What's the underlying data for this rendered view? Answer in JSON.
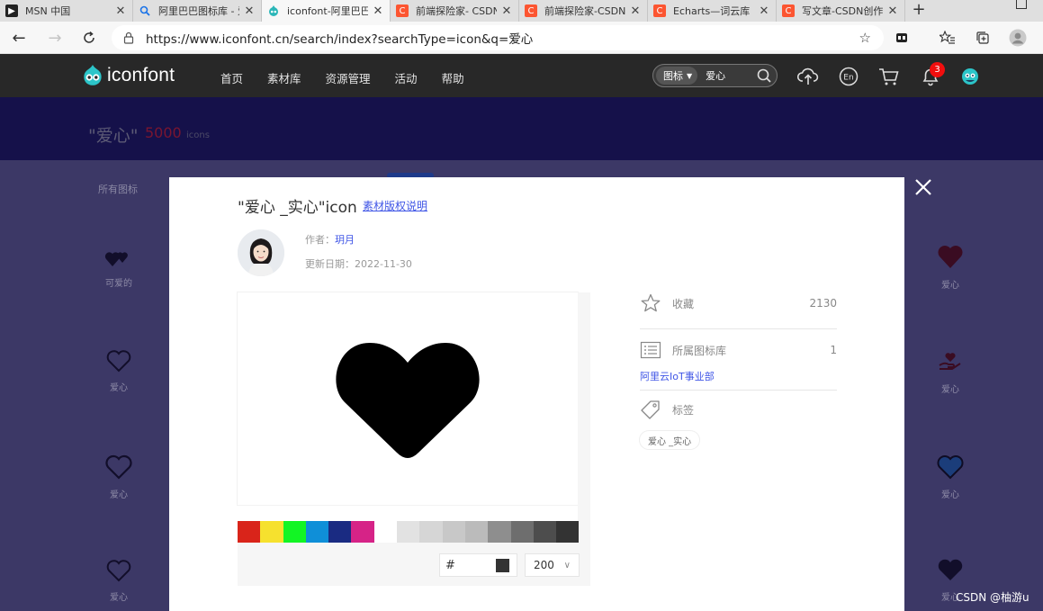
{
  "browser": {
    "tabs": [
      {
        "title": "MSN 中国",
        "icon": "msn-icon",
        "icon_color": "#222222"
      },
      {
        "title": "阿里巴巴图标库 - 爱心",
        "icon": "search-icon",
        "icon_color": "#1a73e8"
      },
      {
        "title": "iconfont-阿里巴巴矢量图标库",
        "icon": "iconfont-icon",
        "icon_color": "#2bb6b8"
      },
      {
        "title": "前端探险家- CSDN博客",
        "icon": "csdn-icon",
        "icon_color": "#fc5531"
      },
      {
        "title": "前端探险家-CSDN博客",
        "icon": "csdn-icon",
        "icon_color": "#fc5531"
      },
      {
        "title": "Echarts—词云库（wordcloud）",
        "icon": "csdn-icon",
        "icon_color": "#fc5531"
      },
      {
        "title": "写文章-CSDN创作中心",
        "icon": "csdn-icon",
        "icon_color": "#fc5531"
      }
    ],
    "url": "https://www.iconfont.cn/search/index?searchType=icon&q=爱心"
  },
  "header": {
    "logo_text": "iconfont",
    "nav": [
      "首页",
      "素材库",
      "资源管理",
      "活动",
      "帮助"
    ],
    "search_type": "图标",
    "search_value": "爱心",
    "notification_count": "3"
  },
  "background": {
    "query": "\"爱心\"",
    "count": "5000",
    "count_unit": "icons",
    "filter_label": "所有图标",
    "icons": [
      {
        "label": "可爱的"
      },
      {
        "label": "爱心"
      },
      {
        "label": "爱心"
      },
      {
        "label": "爱心"
      },
      {
        "label": "爱心"
      },
      {
        "label": "爱心"
      },
      {
        "label": "爱心"
      },
      {
        "label": "爱心"
      }
    ]
  },
  "modal": {
    "title": "\"爱心 _实心\"icon",
    "license_link": "素材版权说明",
    "author_label": "作者：",
    "author_name": "玥月",
    "date_label": "更新日期：",
    "date_value": "2022-11-30",
    "palette": [
      "#d9241a",
      "#f6e12e",
      "#12f524",
      "#0f8fd8",
      "#1a2b82",
      "#d62387",
      "#ffffff",
      "#e2e2e2",
      "#d6d6d6",
      "#c8c8c8",
      "#bbbbbb",
      "#8e8e8e",
      "#6e6e6e",
      "#4d4d4d",
      "#333333"
    ],
    "hex_prefix": "#",
    "current_color": "#333333",
    "size_value": "200",
    "favorites_label": "收藏",
    "favorites_count": "2130",
    "library_label": "所属图标库",
    "library_count": "1",
    "library_name": "阿里云IoT事业部",
    "tags_label": "标签",
    "tags": [
      "爱心 _实心"
    ]
  },
  "watermark": "CSDN @柚游u"
}
